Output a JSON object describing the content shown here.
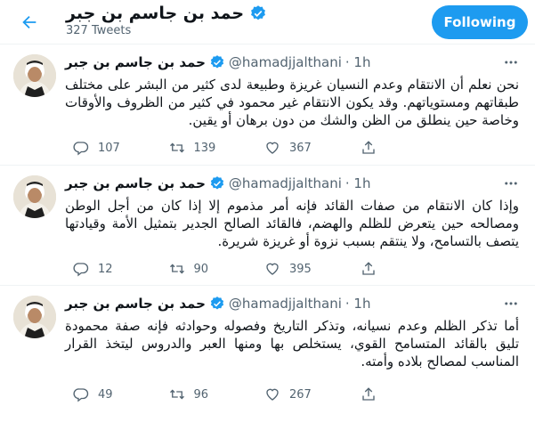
{
  "header": {
    "title": "حمد بن جاسم بن جبر",
    "tweet_count": "327 Tweets",
    "follow_label": "Following"
  },
  "tweets": [
    {
      "name": "حمد بن جاسم بن جبر",
      "handle": "@hamadjjalthani",
      "time": "· 1h",
      "text": "نحن نعلم أن الانتقام وعدم النسيان غريزة وطبيعة لدى كثير من البشر على مختلف طبقاتهم ومستوياتهم. وقد يكون الانتقام غير محمود في كثير من الظروف والأوقات وخاصة حين ينطلق من الظن والشك من دون برهان أو يقين.",
      "replies": "107",
      "retweets": "139",
      "likes": "367"
    },
    {
      "name": "حمد بن جاسم بن جبر",
      "handle": "@hamadjjalthani",
      "time": "· 1h",
      "text": "وإذا كان الانتقام من صفات القائد فإنه أمر مذموم إلا إذا كان من أجل الوطن ومصالحه حين يتعرض للظلم والهضم، فالقائد الصالح الجدير بتمثيل الأمة وقيادتها يتصف بالتسامح، ولا ينتقم بسبب نزوة أو غريزة شريرة.",
      "replies": "12",
      "retweets": "90",
      "likes": "395"
    },
    {
      "name": "حمد بن جاسم بن جبر",
      "handle": "@hamadjjalthani",
      "time": "· 1h",
      "text": "أما تذكر الظلم وعدم نسيانه، وتذكر التاريخ وفصوله وحوادثه فإنه صفة محمودة تليق بالقائد المتسامح القوي، يستخلص بها ومنها العبر والدروس ليتخذ القرار المناسب لمصالح بلاده وأمته.",
      "replies": "49",
      "retweets": "96",
      "likes": "267"
    }
  ],
  "colors": {
    "accent": "#1d9bf0",
    "secondary_text": "#536471",
    "divider": "#eff3f4"
  },
  "icons": {
    "back": "arrow-left-icon",
    "verified": "verified-badge-icon",
    "more": "more-dots-icon",
    "reply": "reply-icon",
    "retweet": "retweet-icon",
    "like": "heart-icon",
    "share": "share-icon"
  }
}
